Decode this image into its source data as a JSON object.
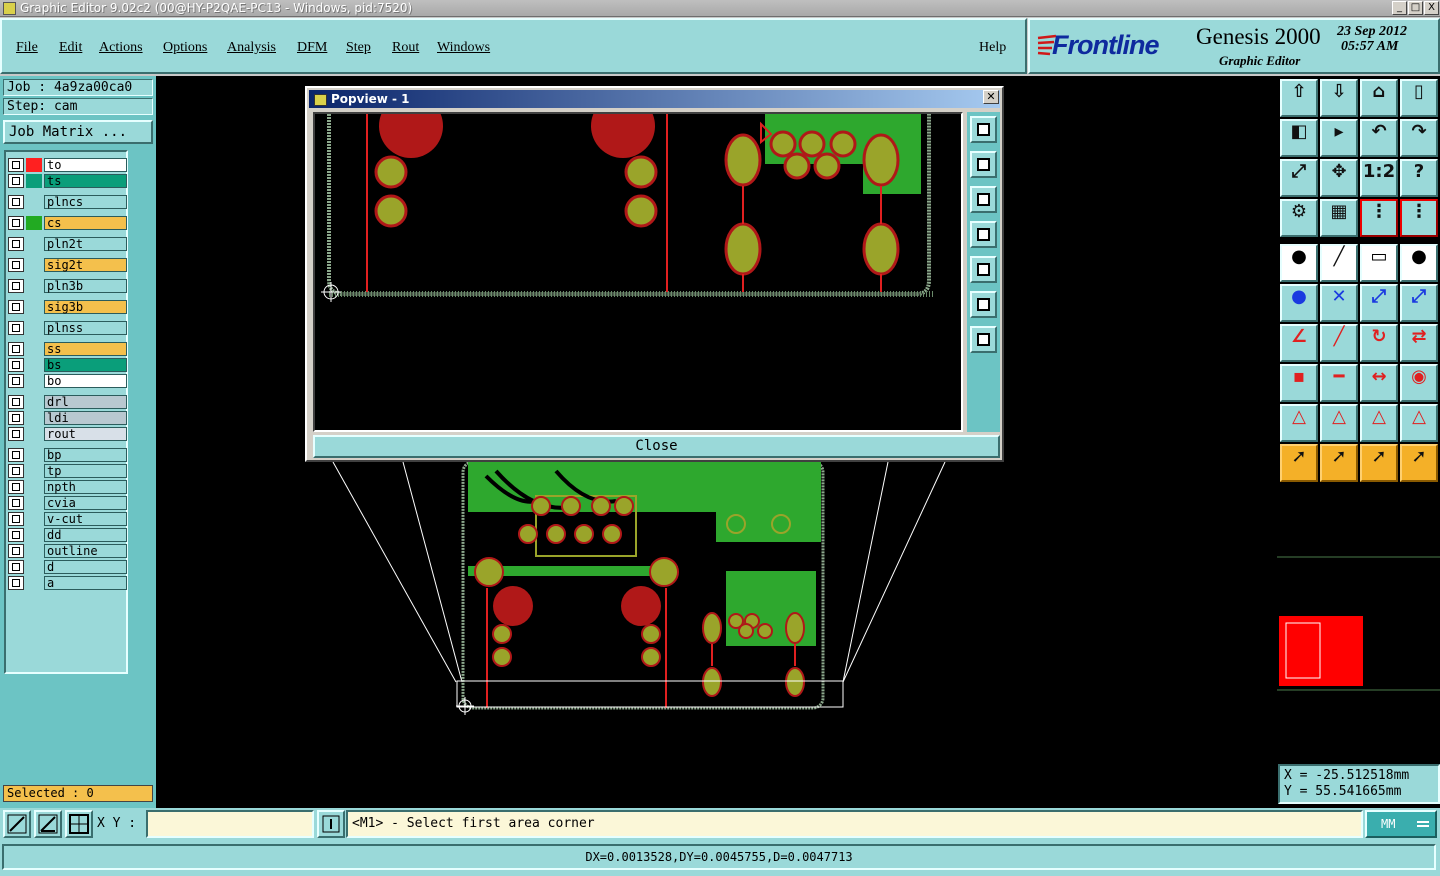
{
  "window": {
    "title": "Graphic Editor 9.02c2 (00@HY-P2QAE-PC13 - Windows, pid:7520)",
    "buttons": [
      "_",
      "□",
      "X"
    ]
  },
  "menu": {
    "items": [
      "File",
      "Edit",
      "Actions",
      "Options",
      "Analysis",
      "DFM",
      "Step",
      "Rout",
      "Windows"
    ],
    "help": "Help"
  },
  "brand": {
    "logo": "Frontline",
    "product": "Genesis 2000",
    "subtitle": "Graphic Editor",
    "date": "23 Sep 2012",
    "time": "05:57 AM"
  },
  "job": {
    "job_label": "Job : 4a9za00ca0",
    "step_label": "Step: cam",
    "matrix_button": "Job Matrix ..."
  },
  "layers": [
    {
      "name": "to",
      "color": "#ffffff",
      "swatch": "#ff2020",
      "active": true
    },
    {
      "name": "ts",
      "color": "#0a9e7a",
      "swatch": "#0a9e7a"
    },
    {
      "name": "plncs",
      "color": "#9ad9d9",
      "swatch": "#9ad9d9"
    },
    {
      "name": "cs",
      "color": "#f4c04c",
      "swatch": "#22aa22"
    },
    {
      "name": "pln2t",
      "color": "#9ad9d9",
      "swatch": "#9ad9d9"
    },
    {
      "name": "sig2t",
      "color": "#f4c04c",
      "swatch": "#9ad9d9"
    },
    {
      "name": "pln3b",
      "color": "#9ad9d9",
      "swatch": "#9ad9d9"
    },
    {
      "name": "sig3b",
      "color": "#f4c04c",
      "swatch": "#9ad9d9"
    },
    {
      "name": "plnss",
      "color": "#9ad9d9",
      "swatch": "#9ad9d9"
    },
    {
      "name": "ss",
      "color": "#f4c04c",
      "swatch": "#9ad9d9"
    },
    {
      "name": "bs",
      "color": "#0a9e7a",
      "swatch": "#9ad9d9"
    },
    {
      "name": "bo",
      "color": "#ffffff",
      "swatch": "#9ad9d9"
    },
    {
      "name": "drl",
      "color": "#b8c8d0",
      "swatch": "#9ad9d9"
    },
    {
      "name": "ldi",
      "color": "#b8c8d0",
      "swatch": "#9ad9d9"
    },
    {
      "name": "rout",
      "color": "#d8e0e8",
      "swatch": "#9ad9d9"
    },
    {
      "name": "bp",
      "color": "#9ad9d9",
      "swatch": "#9ad9d9"
    },
    {
      "name": "tp",
      "color": "#9ad9d9",
      "swatch": "#9ad9d9"
    },
    {
      "name": "npth",
      "color": "#9ad9d9",
      "swatch": "#9ad9d9"
    },
    {
      "name": "cvia",
      "color": "#9ad9d9",
      "swatch": "#9ad9d9"
    },
    {
      "name": "v-cut",
      "color": "#9ad9d9",
      "swatch": "#9ad9d9"
    },
    {
      "name": "dd",
      "color": "#9ad9d9",
      "swatch": "#9ad9d9"
    },
    {
      "name": "outline",
      "color": "#9ad9d9",
      "swatch": "#9ad9d9"
    },
    {
      "name": "d",
      "color": "#9ad9d9",
      "swatch": "#9ad9d9"
    },
    {
      "name": "a",
      "color": "#9ad9d9",
      "swatch": "#9ad9d9"
    }
  ],
  "selected": "Selected : 0",
  "popview": {
    "title": "Popview - 1",
    "close_button": "Close"
  },
  "coords": {
    "x": "X = -25.512518mm",
    "y": "Y = 55.541665mm"
  },
  "bottom": {
    "xy_label": "X Y :",
    "xy_value": "",
    "prompt": "<M1> - Select first area corner",
    "units": "MM",
    "status": "DX=0.0013528,DY=0.0045755,D=0.0047713"
  },
  "colors": {
    "copper": "#9aa42a",
    "pad_red": "#b01818",
    "fill_green": "#2ea82e",
    "trace_red": "#e02020",
    "panel": "#9ad9d9"
  }
}
